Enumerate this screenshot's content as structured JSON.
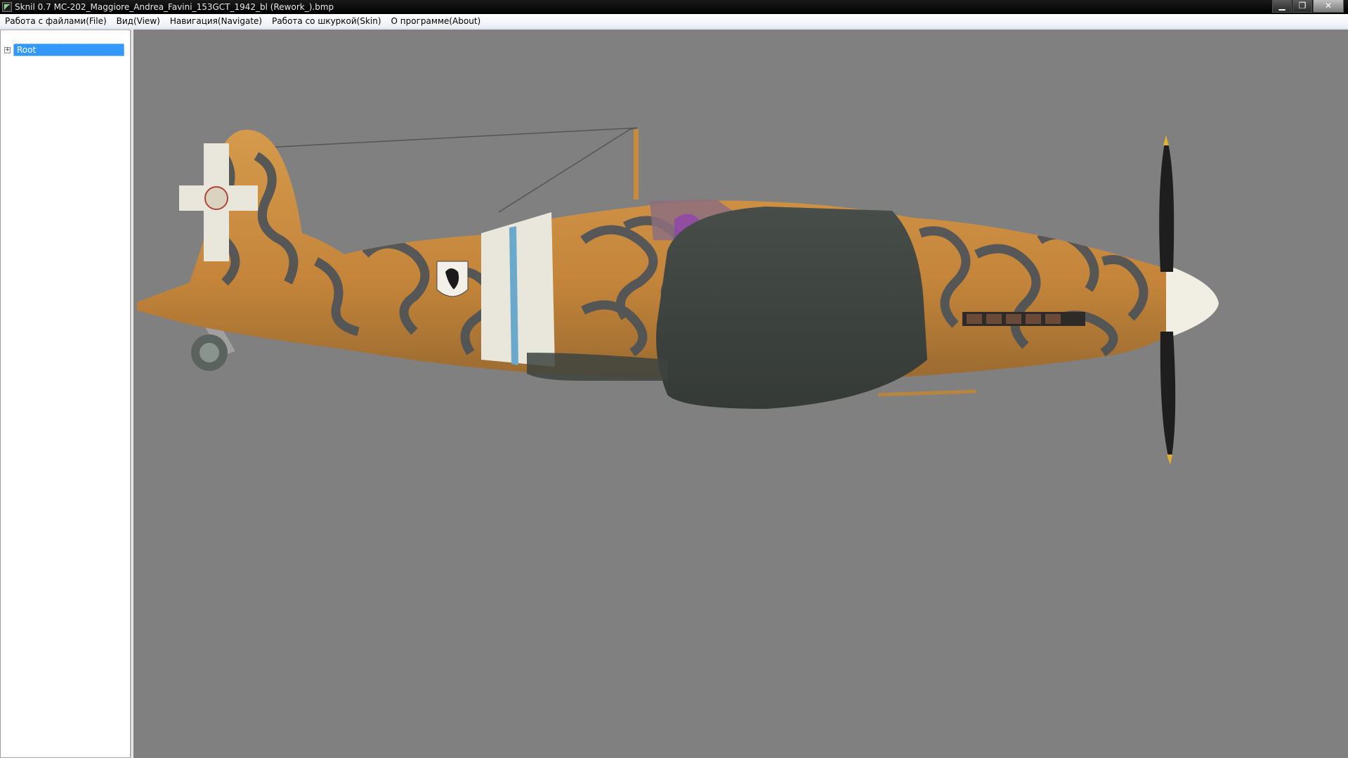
{
  "window": {
    "app_name": "Sknil 0.7",
    "file_title": "MC-202_Maggiore_Andrea_Favini_153GCT_1942_bl (Rework_).bmp"
  },
  "menu": {
    "items": [
      {
        "label": "Работа с файлами(File)"
      },
      {
        "label": "Вид(View)"
      },
      {
        "label": "Навигация(Navigate)"
      },
      {
        "label": "Работа со шкуркой(Skin)"
      },
      {
        "label": "О программе(About)"
      }
    ]
  },
  "tree": {
    "root_label": "Root",
    "expander_symbol": "+"
  },
  "viewport": {
    "background_color": "#808080",
    "model": "aircraft-side-view"
  },
  "colors": {
    "fuselage": "#c98a3c",
    "camo": "#4c5358",
    "wing": "#3d433f",
    "band": "#e9e6db",
    "band_stripe": "#6aa8cc",
    "spinner": "#f1efe4",
    "selection": "#3399ff"
  }
}
